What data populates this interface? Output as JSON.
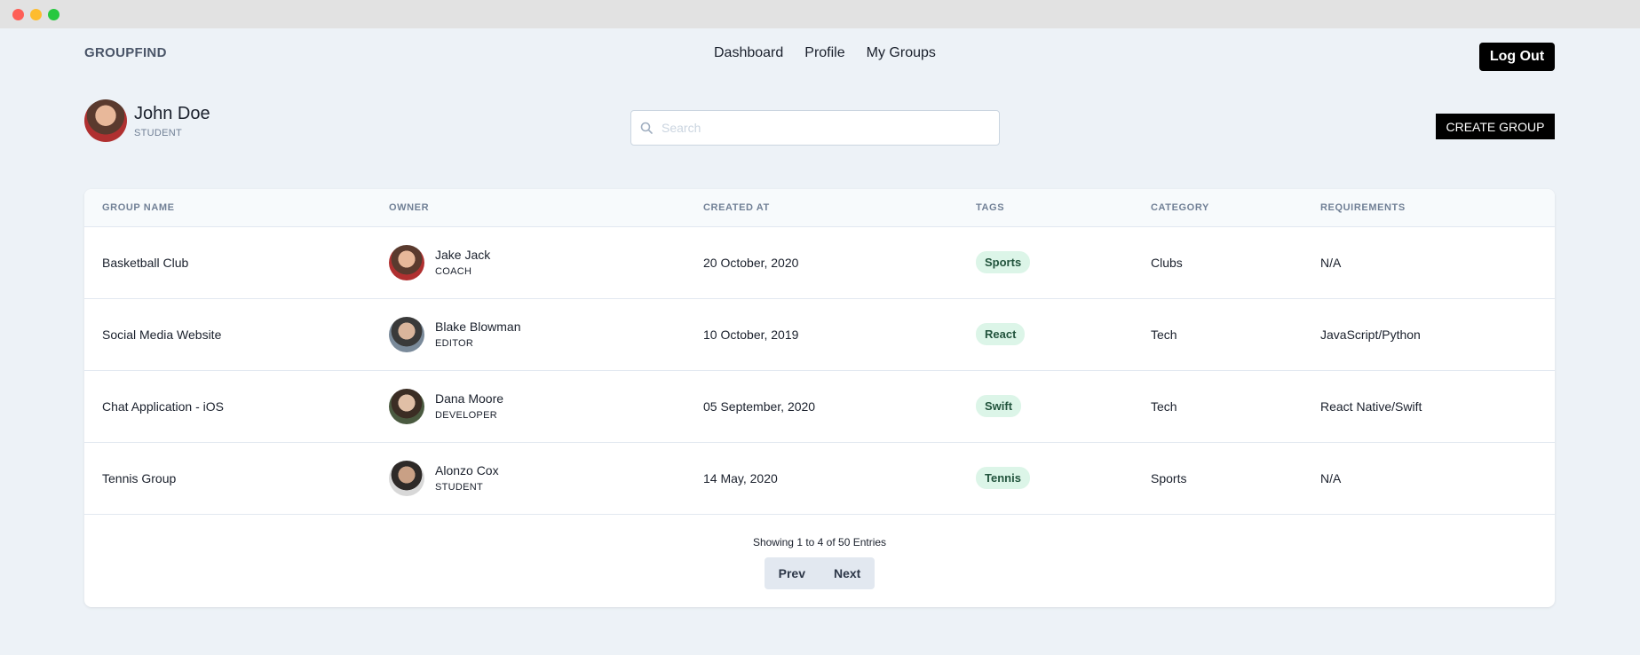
{
  "app": {
    "brand": "GROUPFIND"
  },
  "nav": {
    "dashboard": "Dashboard",
    "profile": "Profile",
    "my_groups": "My Groups"
  },
  "header": {
    "logout_label": "Log Out"
  },
  "user": {
    "name": "John Doe",
    "role": "STUDENT"
  },
  "search": {
    "placeholder": "Search",
    "value": ""
  },
  "actions": {
    "create_group_label": "CREATE GROUP"
  },
  "table": {
    "columns": [
      "GROUP NAME",
      "OWNER",
      "CREATED AT",
      "TAGS",
      "CATEGORY",
      "REQUIREMENTS"
    ],
    "rows": [
      {
        "group_name": "Basketball Club",
        "owner_name": "Jake Jack",
        "owner_role": "COACH",
        "created_at": "20 October, 2020",
        "tag": "Sports",
        "category": "Clubs",
        "requirements": "N/A"
      },
      {
        "group_name": "Social Media Website",
        "owner_name": "Blake Blowman",
        "owner_role": "EDITOR",
        "created_at": "10 October, 2019",
        "tag": "React",
        "category": "Tech",
        "requirements": "JavaScript/Python"
      },
      {
        "group_name": "Chat Application - iOS",
        "owner_name": "Dana Moore",
        "owner_role": "DEVELOPER",
        "created_at": "05 September, 2020",
        "tag": "Swift",
        "category": "Tech",
        "requirements": "React Native/Swift"
      },
      {
        "group_name": "Tennis Group",
        "owner_name": "Alonzo Cox",
        "owner_role": "STUDENT",
        "created_at": "14 May, 2020",
        "tag": "Tennis",
        "category": "Sports",
        "requirements": "N/A"
      }
    ]
  },
  "pagination": {
    "showing": "Showing 1 to 4 of 50 Entries",
    "prev": "Prev",
    "next": "Next"
  },
  "colors": {
    "accent": "#000000",
    "tag_bg": "#dcf5e8",
    "tag_text": "#22543d",
    "page_bg": "#edf2f7"
  }
}
